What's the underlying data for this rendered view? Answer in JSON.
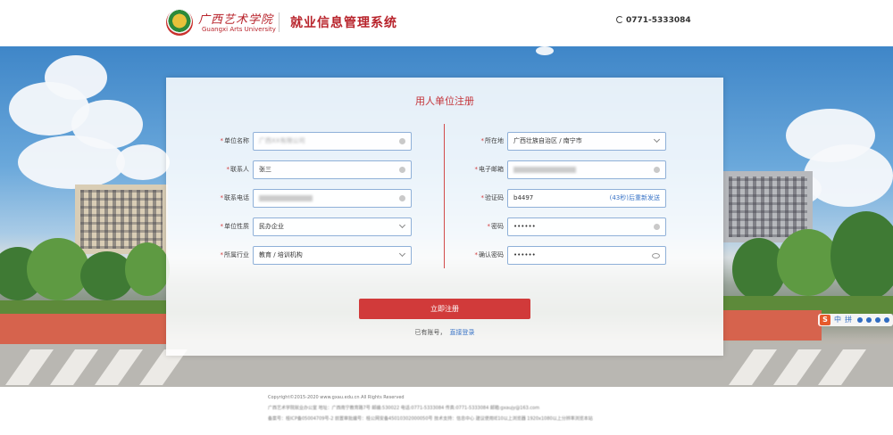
{
  "header": {
    "school_name": "广西艺术学院",
    "school_name_en": "Guangxi Arts University",
    "system_title": "就业信息管理系统",
    "phone": "0771-5333084"
  },
  "form": {
    "title": "用人单位注册",
    "left_fields": [
      {
        "label": "单位名称",
        "value": "广西XX有限公司",
        "blurred": true,
        "suffix": "clear-icon"
      },
      {
        "label": "联系人",
        "value": "张三",
        "blurred": false,
        "suffix": "clear-icon"
      },
      {
        "label": "联系电话",
        "value": "",
        "blurred": true,
        "suffix": "clear-icon"
      },
      {
        "label": "单位性质",
        "value": "民办企业",
        "blurred": false,
        "suffix": "chevron-down-icon"
      },
      {
        "label": "所属行业",
        "value": "教育 / 培训机构",
        "blurred": false,
        "suffix": "chevron-down-icon"
      }
    ],
    "right_fields": [
      {
        "label": "所在地",
        "value": "广西壮族自治区 / 南宁市",
        "blurred": false,
        "suffix": "chevron-down-icon"
      },
      {
        "label": "电子邮箱",
        "value": "",
        "blurred": true,
        "suffix": "clear-icon"
      },
      {
        "label": "验证码",
        "value": "b4497",
        "blurred": false,
        "suffix_text": "(43秒)后重新发送"
      },
      {
        "label": "密码",
        "value": "••••••",
        "blurred": false,
        "suffix": "clear-icon"
      },
      {
        "label": "确认密码",
        "value": "••••••",
        "blurred": false,
        "suffix": "eye-icon"
      }
    ],
    "submit_label": "立即注册",
    "login_prompt": "已有账号，",
    "login_link": "直接登录"
  },
  "ime_toolbar": {
    "logo": "S",
    "items": [
      "中",
      "拼"
    ]
  },
  "footer": {
    "copyright": "Copyright©2015-2020 www.gxau.edu.cn All Rights Reserved",
    "address": "广西艺术学院就业办公室 地址：广西南宁教育路7号 邮编:530022 电话:0771-5333084 传真:0771-5333084 邮箱:gxaujy@163.com",
    "icp": "备案号：桂ICP备05004709号-2 前置审批编号：桂公网安备45010302000050号 技术支持：信息中心 建议使用IE10以上浏览器 1920x1080以上分辨率浏览本站"
  },
  "colors": {
    "brand_red": "#b8232b",
    "button_red": "#d13a3a",
    "link_blue": "#3a74c7",
    "input_border": "#8fb0d8"
  }
}
